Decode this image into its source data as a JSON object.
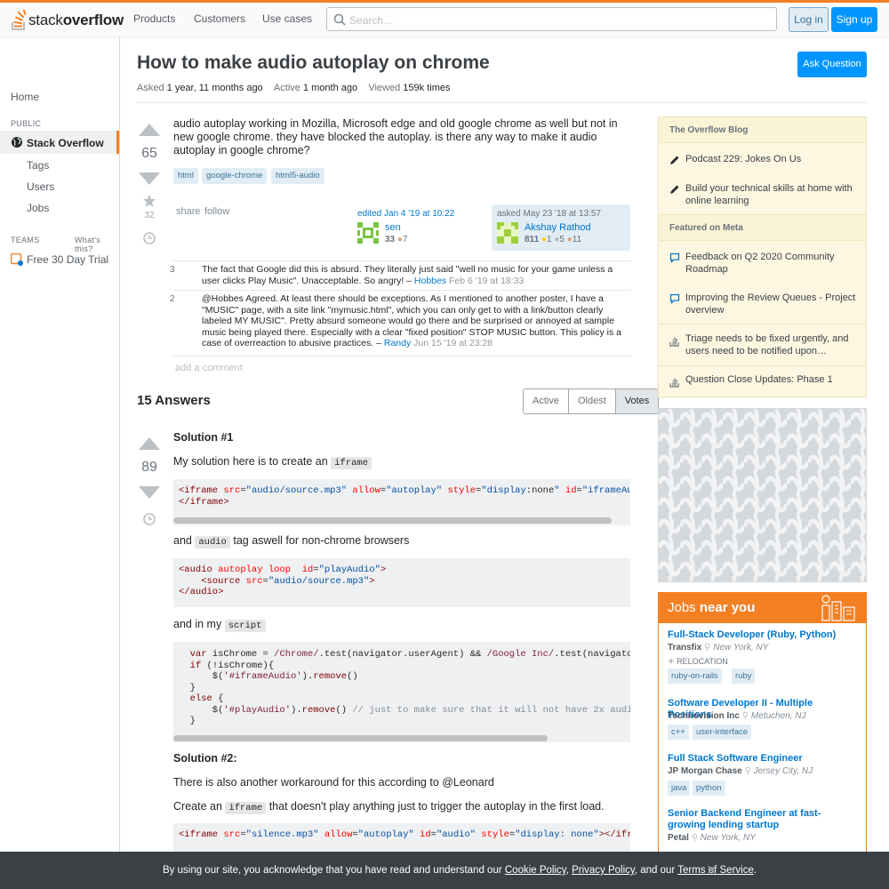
{
  "header": {
    "logo_word1": "stack",
    "logo_word2": "overflow",
    "nav": [
      "Products",
      "Customers",
      "Use cases"
    ],
    "search_placeholder": "Search…",
    "login": "Log in",
    "signup": "Sign up"
  },
  "leftnav": {
    "home": "Home",
    "public_label": "PUBLIC",
    "stackoverflow": "Stack Overflow",
    "tags": "Tags",
    "users": "Users",
    "jobs": "Jobs",
    "teams_label": "TEAMS",
    "whats_this": "What's this?",
    "trial": "Free 30 Day Trial"
  },
  "question": {
    "title": "How to make audio autoplay on chrome",
    "asked_label": "Asked",
    "asked_value": "1 year, 11 months ago",
    "active_label": "Active",
    "active_value": "1 month ago",
    "viewed_label": "Viewed",
    "viewed_value": "159k times",
    "ask_button": "Ask Question",
    "votes": "65",
    "favorites": "32",
    "body": "audio autoplay working in Mozilla, Microsoft edge and old google chrome as well but not in new google chrome. they have blocked the autoplay. is there any way to make it audio autoplay in google chrome?",
    "tags": [
      "html",
      "google-chrome",
      "html5-audio"
    ],
    "share": "share",
    "follow": "follow",
    "edited_label": "edited Jan 4 '19 at 10:22",
    "editor_name": "sen",
    "editor_rep": "33",
    "editor_bronze": "7",
    "asked_sig": "asked May 23 '18 at 13:57",
    "asker_name": "Akshay Rathod",
    "asker_rep": "811",
    "asker_gold": "1",
    "asker_silver": "5",
    "asker_bronze": "11"
  },
  "comments": [
    {
      "score": "3",
      "text": "The fact that Google did this is absurd. They literally just said \"well no music for your game unless a user clicks Play Music\". Unacceptable. So angry! –",
      "user": "Hobbes",
      "date": "Feb 6 '19 at 18:33"
    },
    {
      "score": "2",
      "text": "@Hobbes Agreed. At least there should be exceptions. As I mentioned to another poster, I have a \"MUSIC\" page, with a site link \"mymusic.html\", which you can only get to with a link/button clearly labeled MY MUSIC\". Pretty absurd someone would go there and be surprised or annoyed at sample music being played there. Especially with a clear \"fixed position\" STOP MUSIC button. This policy is a case of overreaction to abusive practices. –",
      "user": "Randy",
      "date": "Jun 15 '19 at 23:28"
    }
  ],
  "add_comment": "add a comment",
  "answers": {
    "count_label": "15 Answers",
    "sort_tabs": [
      "Active",
      "Oldest",
      "Votes"
    ],
    "votes": "89",
    "solution1": "Solution #1",
    "p1_pre": "My solution here is to create an",
    "p1_code": "iframe",
    "p2_pre": "and",
    "p2_code": "audio",
    "p2_post": "tag aswell for non-chrome browsers",
    "p3_pre": "and in my",
    "p3_code": "script",
    "solution2": "Solution #2:",
    "p4": "There is also another workaround for this according to @Leonard",
    "p5_pre": "Create an",
    "p5_code": "iframe",
    "p5_post": "that doesn't play anything just to trigger the autoplay in the first load."
  },
  "blog": {
    "blog_header": "The Overflow Blog",
    "blog_items": [
      "Podcast 229: Jokes On Us",
      "Build your technical skills at home with online learning"
    ],
    "meta_header": "Featured on Meta",
    "meta_items": [
      "Feedback on Q2 2020 Community Roadmap",
      "Improving the Review Queues - Project overview",
      "Triage needs to be fixed urgently, and users need to be notified upon…",
      "Question Close Updates: Phase 1"
    ]
  },
  "jobs": {
    "header_pre": "Jobs",
    "header_bold": "near you",
    "relocation": "RELOCATION",
    "list": [
      {
        "title": "Full-Stack Developer (Ruby, Python)",
        "company": "Transfix",
        "location": "New York, NY",
        "tags": [
          "ruby-on-rails",
          "ruby"
        ]
      },
      {
        "title": "Software Developer II - Multiple Positions",
        "company": "Technovision Inc",
        "location": "Metuchen, NJ",
        "tags": [
          "c++",
          "user-interface"
        ]
      },
      {
        "title": "Full Stack Software Engineer",
        "company": "JP Morgan Chase",
        "location": "Jersey City, NJ",
        "tags": [
          "java",
          "python"
        ]
      },
      {
        "title": "Senior Backend Engineer at fast-growing lending startup",
        "company": "Petal",
        "location": "New York, NY",
        "tags": []
      }
    ]
  },
  "cookie": {
    "pre": "By using our site, you acknowledge that you have read and understand our",
    "cookie_policy": "Cookie Policy",
    "privacy_policy": "Privacy Policy",
    "and_our": ", and our",
    "terms": "Terms of Service",
    "period": "."
  },
  "colors": {
    "accent": "#f48024",
    "link": "#0077cc",
    "button": "#0095ff"
  }
}
